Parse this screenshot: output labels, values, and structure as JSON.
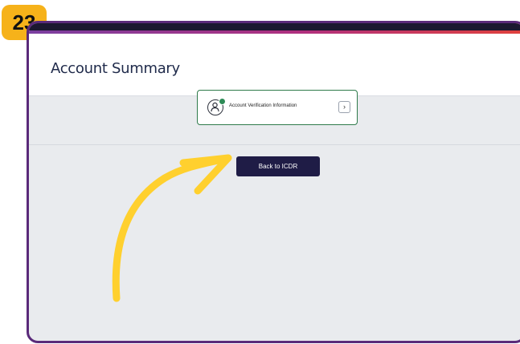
{
  "step_badge": "23",
  "header": {
    "title": "Account Summary"
  },
  "card": {
    "label": "Account Verification Information",
    "chevron": "›"
  },
  "back_button": {
    "label": "Back to ICDR"
  },
  "colors": {
    "frame": "#5a2a7a",
    "card_border": "#2e7a4a",
    "button_bg": "#1f1c46",
    "badge": "#f6b21a",
    "arrow": "#ffd02e"
  },
  "icons": [
    "user-check-icon",
    "chevron-right-icon",
    "curved-arrow-annotation"
  ]
}
